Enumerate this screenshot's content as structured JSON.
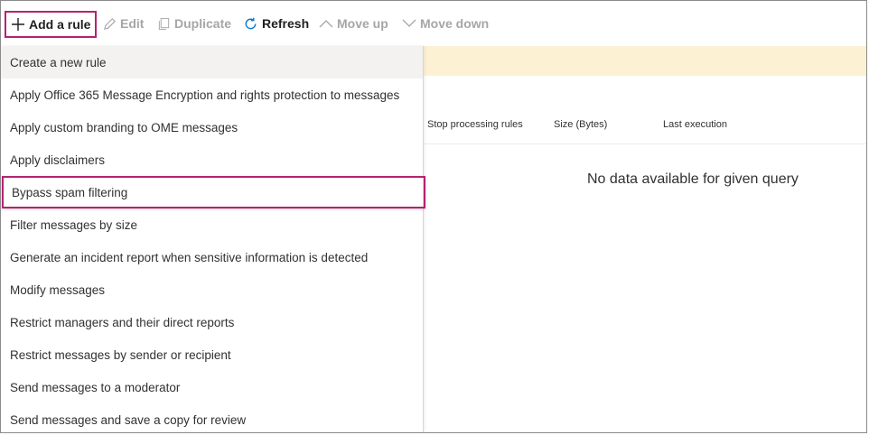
{
  "toolbar": {
    "add_rule": "Add a rule",
    "edit": "Edit",
    "duplicate": "Duplicate",
    "refresh": "Refresh",
    "move_up": "Move up",
    "move_down": "Move down"
  },
  "table": {
    "columns": [
      "Stop processing rules",
      "Size (Bytes)",
      "Last execution"
    ],
    "empty_message": "No data available for given query"
  },
  "menu": {
    "items": [
      "Create a new rule",
      "Apply Office 365 Message Encryption and rights protection to messages",
      "Apply custom branding to OME messages",
      "Apply disclaimers",
      "Bypass spam filtering",
      "Filter messages by size",
      "Generate an incident report when sensitive information is detected",
      "Modify messages",
      "Restrict managers and their direct reports",
      "Restrict messages by sender or recipient",
      "Send messages to a moderator",
      "Send messages and save a copy for review"
    ]
  },
  "colors": {
    "highlight": "#b4236f",
    "banner": "#fdf1d4",
    "refresh_icon": "#0078d4"
  },
  "icons": [
    "plus-icon",
    "pencil-icon",
    "copy-icon",
    "refresh-icon",
    "chevron-up-icon",
    "chevron-down-icon"
  ]
}
